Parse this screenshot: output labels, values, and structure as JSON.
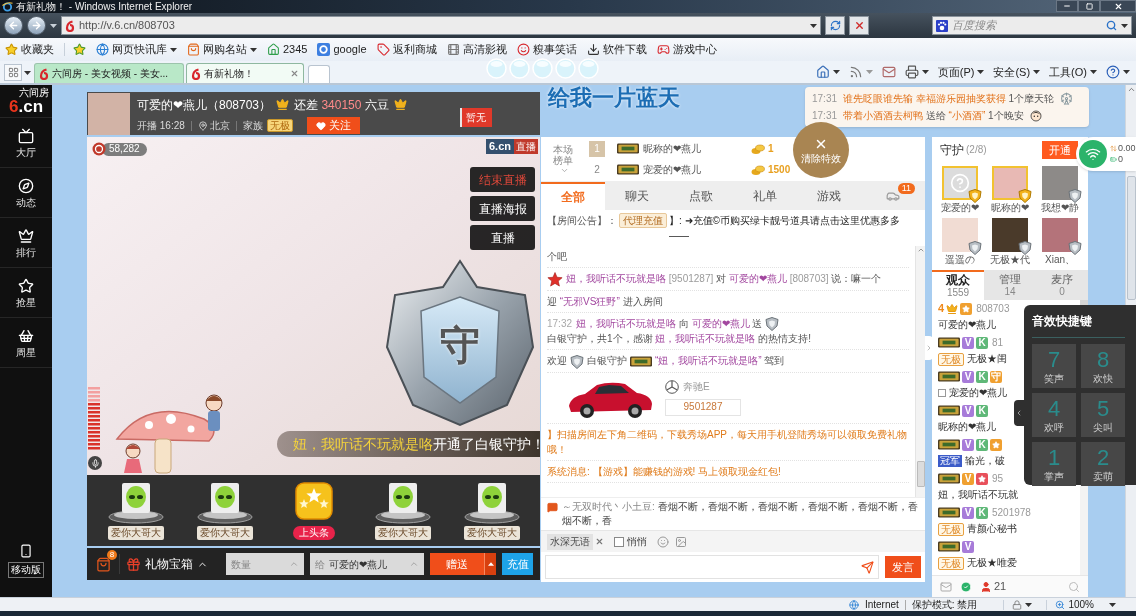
{
  "window": {
    "title": "有新礼物！ - Windows Internet Explorer"
  },
  "address_bar": {
    "url": "http://v.6.cn/808703"
  },
  "search": {
    "placeholder": "百度搜索"
  },
  "favorites": [
    {
      "label": "收藏夹",
      "dropdown": false
    },
    {
      "label": "网页快讯库",
      "dropdown": true
    },
    {
      "label": "网购名站",
      "dropdown": true
    },
    {
      "label": "2345",
      "dropdown": false
    },
    {
      "label": "google",
      "dropdown": false
    },
    {
      "label": "返利商城",
      "dropdown": false
    },
    {
      "label": "高清影视",
      "dropdown": false
    },
    {
      "label": "糗事笑话",
      "dropdown": false
    },
    {
      "label": "软件下载",
      "dropdown": false
    },
    {
      "label": "游戏中心",
      "dropdown": false
    }
  ],
  "browser_tabs": [
    {
      "label": "六间房 - 美女视频 - 美女...",
      "selected": false
    },
    {
      "label": "有新礼物！",
      "selected": true
    }
  ],
  "command_bar": [
    "页面(P)",
    "安全(S)",
    "工具(O)"
  ],
  "desktop_widget": {
    "text": "给我一片蓝天"
  },
  "site_nav": {
    "logo": "6.cn",
    "logo_caption": "六间房",
    "items": [
      "大厅",
      "动态",
      "排行",
      "抢星",
      "周星"
    ],
    "mobile": "移动版"
  },
  "room_header": {
    "anchor": "可爱的❤燕儿（808703）",
    "gap_label": "还差",
    "gap_amount": "340150",
    "gap_unit": "六豆",
    "start": "开播 16:28",
    "location": "北京",
    "family_label": "家族",
    "family_badge": "无极",
    "follow": "关注",
    "flag": "暂无"
  },
  "notifications": [
    {
      "time": "17:31",
      "segments": [
        {
          "kind": "name",
          "text": "谁先眨眼谁先输"
        },
        {
          "kind": "name",
          "text": "幸福游乐园抽奖获得"
        },
        {
          "kind": "plain",
          "text": "1个摩天轮"
        }
      ]
    },
    {
      "time": "17:31",
      "segments": [
        {
          "kind": "name",
          "text": "带着小酒酒去柯鸭"
        },
        {
          "kind": "plain",
          "text": "送给"
        },
        {
          "kind": "name",
          "text": "“小酒酒”"
        },
        {
          "kind": "plain",
          "text": "1个晚安"
        }
      ]
    }
  ],
  "video": {
    "viewers": "58,282",
    "logo": "6.cn",
    "live": "直播",
    "controls": [
      {
        "label": "结束直播",
        "kind": "end"
      },
      {
        "label": "直播海报",
        "kind": "normal"
      },
      {
        "label": "直播",
        "kind": "normal"
      }
    ],
    "shield_glyph": "守",
    "banner": {
      "name": "妞，我听话不玩就是咯",
      "text": "开通了白银守护！"
    }
  },
  "gifts": [
    {
      "label": "爱你大哥大",
      "kind": "alien"
    },
    {
      "label": "爱你大哥大",
      "kind": "alien"
    },
    {
      "label": "上头条",
      "kind": "headline"
    },
    {
      "label": "爱你大哥大",
      "kind": "alien"
    },
    {
      "label": "爱你大哥大",
      "kind": "alien"
    }
  ],
  "gift_bar": {
    "bag_count": "8",
    "treasure": "礼物宝箱",
    "quantity_placeholder": "数量",
    "to_label": "给",
    "recipient": "可爱的❤燕儿",
    "send": "赠送",
    "recharge": "充值"
  },
  "chat": {
    "ranking": {
      "label": "本场榜单",
      "rows": [
        {
          "rank": "1",
          "top": true,
          "name": "昵称的❤燕儿",
          "coins": "1"
        },
        {
          "rank": "2",
          "top": false,
          "name": "宠爱的❤燕儿",
          "coins": "1500"
        }
      ]
    },
    "clear_effects": "清除特效",
    "tabs": [
      {
        "label": "全部",
        "selected": true
      },
      {
        "label": "聊天",
        "selected": false
      },
      {
        "label": "点歌",
        "selected": false
      },
      {
        "label": "礼单",
        "selected": false
      },
      {
        "label": "游戏",
        "selected": false
      }
    ],
    "car_count": "11",
    "notice": {
      "label": "【房间公告】：",
      "tag": "代理充值",
      "text": "】: ➜充值©币购买绿卡靓号道具请点击这里优惠多多——"
    },
    "messages": [
      {
        "kind": "line",
        "segments": [
          {
            "kind": "plain",
            "text": "个吧"
          }
        ]
      },
      {
        "kind": "line",
        "segments": [
          {
            "kind": "star"
          },
          {
            "kind": "name",
            "text": "妞，我听话不玩就是咯"
          },
          {
            "kind": "id",
            "text": "[9501287]"
          },
          {
            "kind": "plain",
            "text": "对"
          },
          {
            "kind": "name",
            "text": "可爱的❤燕儿"
          },
          {
            "kind": "id",
            "text": "[808703]"
          },
          {
            "kind": "plain",
            "text": "说：嘛一个"
          }
        ]
      },
      {
        "kind": "line",
        "segments": [
          {
            "kind": "plain",
            "text": "迎"
          },
          {
            "kind": "name",
            "text": "“无邪VS狂野”"
          },
          {
            "kind": "plain",
            "text": "进入房间"
          }
        ]
      },
      {
        "kind": "line",
        "segments": [
          {
            "kind": "time",
            "text": "17:32"
          },
          {
            "kind": "name",
            "text": "妞，我听话不玩就是咯"
          },
          {
            "kind": "plain",
            "text": "向"
          },
          {
            "kind": "name",
            "text": "可爱的❤燕儿"
          },
          {
            "kind": "plain",
            "text": "送"
          },
          {
            "kind": "guard"
          },
          {
            "kind": "plain",
            "text": "白银守护，共1个，感谢"
          },
          {
            "kind": "name",
            "text": "妞，我听话不玩就是咯"
          },
          {
            "kind": "plain",
            "text": "的热情支持!"
          }
        ]
      },
      {
        "kind": "line",
        "segments": [
          {
            "kind": "plain",
            "text": "欢迎"
          },
          {
            "kind": "guard"
          },
          {
            "kind": "plain",
            "text": "白银守护"
          },
          {
            "kind": "badge"
          },
          {
            "kind": "name",
            "text": "“妞，我听话不玩就是咯”"
          },
          {
            "kind": "plain",
            "text": "驾到"
          }
        ]
      },
      {
        "kind": "car",
        "car": "奔驰E",
        "user_id": "9501287"
      },
      {
        "kind": "line",
        "segments": [
          {
            "kind": "notice",
            "text": "】扫描房间左下角二维码，下载秀场APP，每天用手机登陆秀场可以领取免费礼物哦！"
          }
        ]
      },
      {
        "kind": "line",
        "segments": [
          {
            "kind": "notice",
            "text": "系统消息: 【游戏】能赚钱的游戏! 马上领取现金红包!"
          }
        ]
      }
    ],
    "marquee": {
      "sender": "～无双时代丶小土豆:",
      "text": "香烟不断，香烟不断，香烟不断，香烟不断，香烟不断，香烟不断，香"
    },
    "input": {
      "chip": "水深无语",
      "whisper_label": "悄悄",
      "whisper": false,
      "send": "发言"
    }
  },
  "guard": {
    "title": "守护",
    "count": "(2/8)",
    "open": "开通",
    "members": [
      {
        "name": "宠爱的❤",
        "gold": true,
        "photo": false
      },
      {
        "name": "昵称的❤",
        "gold": true,
        "photo": true
      },
      {
        "name": "我想❤静",
        "gold": false,
        "photo": true
      },
      {
        "name": "遥遥の",
        "gold": false,
        "photo": true
      },
      {
        "name": "无极★代",
        "gold": false,
        "photo": true
      },
      {
        "name": "Xian、",
        "gold": false,
        "photo": true
      }
    ]
  },
  "audience_tabs": [
    {
      "label": "观众",
      "count": "1559",
      "selected": true
    },
    {
      "label": "管理",
      "count": "14",
      "selected": false
    },
    {
      "label": "麦序",
      "count": "0",
      "selected": false
    }
  ],
  "audience": [
    {
      "level": "4",
      "rank_badge": false,
      "tags": [
        {
          "kind": "star",
          "color": "#f0a030"
        }
      ],
      "id": "808703",
      "name": "可爱的❤燕儿"
    },
    {
      "rank_badge": true,
      "tags": [
        {
          "kind": "letter",
          "text": "V",
          "color": "#a77bd9"
        },
        {
          "kind": "letter",
          "text": "K",
          "color": "#5fb878"
        }
      ],
      "id": "81",
      "prefix": {
        "kind": "family",
        "text": "无极"
      },
      "name": "无极★闺"
    },
    {
      "rank_badge": true,
      "tags": [
        {
          "kind": "letter",
          "text": "V",
          "color": "#a77bd9"
        },
        {
          "kind": "letter",
          "text": "K",
          "color": "#5fb878"
        },
        {
          "kind": "letter",
          "text": "守",
          "color": "#f0a030"
        }
      ],
      "prefix": {
        "kind": "square"
      },
      "name": "宠爱的❤燕儿"
    },
    {
      "rank_badge": true,
      "tags": [
        {
          "kind": "letter",
          "text": "V",
          "color": "#a77bd9"
        },
        {
          "kind": "letter",
          "text": "K",
          "color": "#5fb878"
        }
      ],
      "name": "昵称的❤燕儿"
    },
    {
      "rank_badge": true,
      "tags": [
        {
          "kind": "letter",
          "text": "V",
          "color": "#a77bd9"
        },
        {
          "kind": "letter",
          "text": "K",
          "color": "#5fb878"
        },
        {
          "kind": "star",
          "color": "#f0a030"
        }
      ],
      "prefix": {
        "kind": "honor",
        "text": "冠军"
      },
      "name": "输光，破"
    },
    {
      "rank_badge": true,
      "tags": [
        {
          "kind": "letter",
          "text": "V",
          "color": "#f0a030"
        },
        {
          "kind": "star",
          "color": "#e8505b"
        }
      ],
      "id": "95",
      "name": "妞，我听话不玩就"
    },
    {
      "rank_badge": true,
      "tags": [
        {
          "kind": "letter",
          "text": "V",
          "color": "#a77bd9"
        },
        {
          "kind": "letter",
          "text": "K",
          "color": "#5fb878"
        }
      ],
      "id": "5201978",
      "prefix": {
        "kind": "family",
        "text": "无极"
      },
      "name": "青颜心秘书"
    },
    {
      "rank_badge": true,
      "tags": [
        {
          "kind": "letter",
          "text": "V",
          "color": "#a77bd9"
        }
      ],
      "prefix": {
        "kind": "family",
        "text": "无极"
      },
      "name": "无极★唯爱"
    }
  ],
  "online_count": "21",
  "wifi_widget": {
    "speed": "0.00",
    "count": "0"
  },
  "sound_panel": {
    "title": "音效快捷键",
    "keys": [
      {
        "key": "7",
        "label": "笑声"
      },
      {
        "key": "8",
        "label": "欢快"
      },
      {
        "key": "4",
        "label": "欢呼"
      },
      {
        "key": "5",
        "label": "尖叫"
      },
      {
        "key": "1",
        "label": "掌声"
      },
      {
        "key": "2",
        "label": "卖萌"
      }
    ]
  },
  "status_bar": {
    "zone": "Internet",
    "mode": "保护模式: 禁用",
    "zoom": "100%"
  }
}
